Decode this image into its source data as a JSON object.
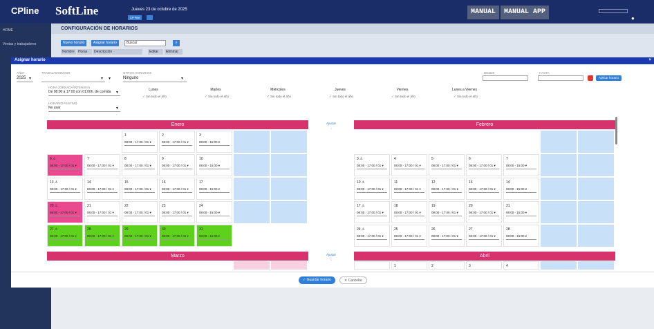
{
  "topbar": {
    "logo_brand": "CPline",
    "logo_product": "SoftLine",
    "date_line": "Jueves 23 de octubre de 2025",
    "badge_left": "CP Pilot",
    "manual_btn": "MANUAL",
    "manual_app_btn": "MANUAL APP",
    "user_icon": "user-icon"
  },
  "sidebar": {
    "items": [
      "HOME",
      "Ventas y trabajadores"
    ]
  },
  "page": {
    "title": "CONFIGURACIÓN DE HORARIOS"
  },
  "toolbar": {
    "btn_new": "Nuevo horario",
    "btn_assign": "Asignar horario",
    "search_placeholder": "Buscar",
    "col_headers": [
      "Nombre",
      "Horas",
      "Descripción",
      "Editar",
      "Eliminar"
    ]
  },
  "dialog": {
    "title": "Asignar horario",
    "year_label": "AÑO*",
    "year_value": "2025",
    "worker_label": "TRABAJADOR/DOR",
    "calendar_label": "OTROS HORARIOS",
    "calendar_value": "Ninguno",
    "desde_label": "DESDE",
    "hasta_label": "HASTA",
    "apply_label": "Aplicar horario",
    "horario_label": "HORA JORNADA/INTENSIVA",
    "horario_value": "De 08:00 a 17:00 con 01:00h. de comida",
    "festivo_label": "HORARIO FESTIVO",
    "festivo_value": "No usar",
    "weekdays": [
      {
        "name": "Lunes",
        "sub": "Sin todo el año"
      },
      {
        "name": "Martes",
        "sub": "Sin todo el año"
      },
      {
        "name": "Miércoles",
        "sub": "Sin todo el año"
      },
      {
        "name": "Jueves",
        "sub": "Sin todo el año"
      },
      {
        "name": "Viernes",
        "sub": "Sin todo el año"
      },
      {
        "name": "Lunes a Viernes",
        "sub": "Sin todo el año"
      }
    ],
    "ajuste_label": "Ajustar",
    "months": {
      "m1": "Enero",
      "m2": "Febrero",
      "m3": "Marzo",
      "m4": "Abril"
    },
    "save_button": "Guardar horario",
    "cancel_button": "Cancelar"
  },
  "calendar": {
    "enero": [
      [
        {
          "day": "",
          "color": "none"
        },
        {
          "day": "",
          "color": "none"
        },
        {
          "day": "1",
          "time": "08:00 - 17:00 / 01 ▾",
          "color": "white"
        },
        {
          "day": "2",
          "time": "08:00 - 17:00 / 01 ▾",
          "color": "white"
        },
        {
          "day": "3",
          "time": "08:00 - 15:00 ▾",
          "color": "white"
        },
        {
          "day": "",
          "color": "blue"
        },
        {
          "day": "",
          "color": "blue"
        }
      ],
      [
        {
          "day": "6 ⚠",
          "time": "08:00 - 17:00 / 01 ▾",
          "color": "pink"
        },
        {
          "day": "7",
          "time": "08:00 - 17:00 / 01 ▾",
          "color": "white"
        },
        {
          "day": "8",
          "time": "08:00 - 17:00 / 01 ▾",
          "color": "white"
        },
        {
          "day": "9",
          "time": "08:00 - 17:00 / 01 ▾",
          "color": "white"
        },
        {
          "day": "10",
          "time": "08:00 - 15:00 ▾",
          "color": "white"
        },
        {
          "day": "",
          "color": "blue"
        },
        {
          "day": "",
          "color": "blue"
        }
      ],
      [
        {
          "day": "13 ⚠",
          "time": "08:00 - 17:00 / 01 ▾",
          "color": "white"
        },
        {
          "day": "14",
          "time": "08:00 - 17:00 / 01 ▾",
          "color": "white"
        },
        {
          "day": "15",
          "time": "08:00 - 17:00 / 01 ▾",
          "color": "white"
        },
        {
          "day": "16",
          "time": "08:00 - 17:00 / 01 ▾",
          "color": "white"
        },
        {
          "day": "17",
          "time": "08:00 - 15:00 ▾",
          "color": "white"
        },
        {
          "day": "",
          "color": "blue"
        },
        {
          "day": "",
          "color": "blue"
        }
      ],
      [
        {
          "day": "20 ⚠",
          "time": "08:00 - 17:00 / 01 ▾",
          "color": "pink"
        },
        {
          "day": "21",
          "time": "08:00 - 17:00 / 01 ▾",
          "color": "white"
        },
        {
          "day": "22",
          "time": "08:00 - 17:00 / 01 ▾",
          "color": "white"
        },
        {
          "day": "23",
          "time": "08:00 - 17:00 / 01 ▾",
          "color": "white"
        },
        {
          "day": "24",
          "time": "08:00 - 15:00 ▾",
          "color": "white"
        },
        {
          "day": "",
          "color": "blue"
        },
        {
          "day": "",
          "color": "blue"
        }
      ],
      [
        {
          "day": "27 ⚠",
          "time": "08:00 - 17:00 / 01 ▾",
          "color": "green"
        },
        {
          "day": "28",
          "time": "08:00 - 17:00 / 01 ▾",
          "color": "green"
        },
        {
          "day": "29",
          "time": "08:00 - 17:00 / 01 ▾",
          "color": "green"
        },
        {
          "day": "30",
          "time": "08:00 - 17:00 / 01 ▾",
          "color": "green"
        },
        {
          "day": "31",
          "time": "08:00 - 15:00 ▾",
          "color": "green"
        },
        {
          "day": "",
          "color": "none"
        },
        {
          "day": "",
          "color": "none"
        }
      ]
    ],
    "febrero": [
      [
        {
          "day": "",
          "color": "none"
        },
        {
          "day": "",
          "color": "none"
        },
        {
          "day": "",
          "color": "none"
        },
        {
          "day": "",
          "color": "none"
        },
        {
          "day": "",
          "color": "none"
        },
        {
          "day": "",
          "color": "blue"
        },
        {
          "day": "",
          "color": "blue"
        }
      ],
      [
        {
          "day": "3 ⚠",
          "time": "08:00 - 17:00 / 01 ▾",
          "color": "white"
        },
        {
          "day": "4",
          "time": "08:00 - 17:00 / 01 ▾",
          "color": "white"
        },
        {
          "day": "5",
          "time": "08:00 - 17:00 / 01 ▾",
          "color": "white"
        },
        {
          "day": "6",
          "time": "08:00 - 17:00 / 01 ▾",
          "color": "white"
        },
        {
          "day": "7",
          "time": "08:00 - 15:00 ▾",
          "color": "white"
        },
        {
          "day": "",
          "color": "blue"
        },
        {
          "day": "",
          "color": "blue"
        }
      ],
      [
        {
          "day": "10 ⚠",
          "time": "08:00 - 17:00 / 01 ▾",
          "color": "white"
        },
        {
          "day": "11",
          "time": "08:00 - 17:00 / 01 ▾",
          "color": "white"
        },
        {
          "day": "12",
          "time": "08:00 - 17:00 / 01 ▾",
          "color": "white"
        },
        {
          "day": "13",
          "time": "08:00 - 17:00 / 01 ▾",
          "color": "white"
        },
        {
          "day": "14",
          "time": "08:00 - 15:00 ▾",
          "color": "white"
        },
        {
          "day": "",
          "color": "blue"
        },
        {
          "day": "",
          "color": "blue"
        }
      ],
      [
        {
          "day": "17 ⚠",
          "time": "08:00 - 17:00 / 01 ▾",
          "color": "white"
        },
        {
          "day": "18",
          "time": "08:00 - 17:00 / 01 ▾",
          "color": "white"
        },
        {
          "day": "19",
          "time": "08:00 - 17:00 / 01 ▾",
          "color": "white"
        },
        {
          "day": "20",
          "time": "08:00 - 17:00 / 01 ▾",
          "color": "white"
        },
        {
          "day": "21",
          "time": "08:00 - 15:00 ▾",
          "color": "white"
        },
        {
          "day": "",
          "color": "blue"
        },
        {
          "day": "",
          "color": "blue"
        }
      ],
      [
        {
          "day": "24 ⚠",
          "time": "08:00 - 17:00 / 01 ▾",
          "color": "white"
        },
        {
          "day": "25",
          "time": "08:00 - 17:00 / 01 ▾",
          "color": "white"
        },
        {
          "day": "26",
          "time": "08:00 - 17:00 / 01 ▾",
          "color": "white"
        },
        {
          "day": "27",
          "time": "08:00 - 17:00 / 01 ▾",
          "color": "white"
        },
        {
          "day": "28",
          "time": "08:00 - 15:00 ▾",
          "color": "white"
        },
        {
          "day": "",
          "color": "blue"
        },
        {
          "day": "",
          "color": "blue"
        }
      ]
    ],
    "abril_row": [
      "",
      "1",
      "2",
      "3",
      "4",
      "",
      ""
    ]
  }
}
